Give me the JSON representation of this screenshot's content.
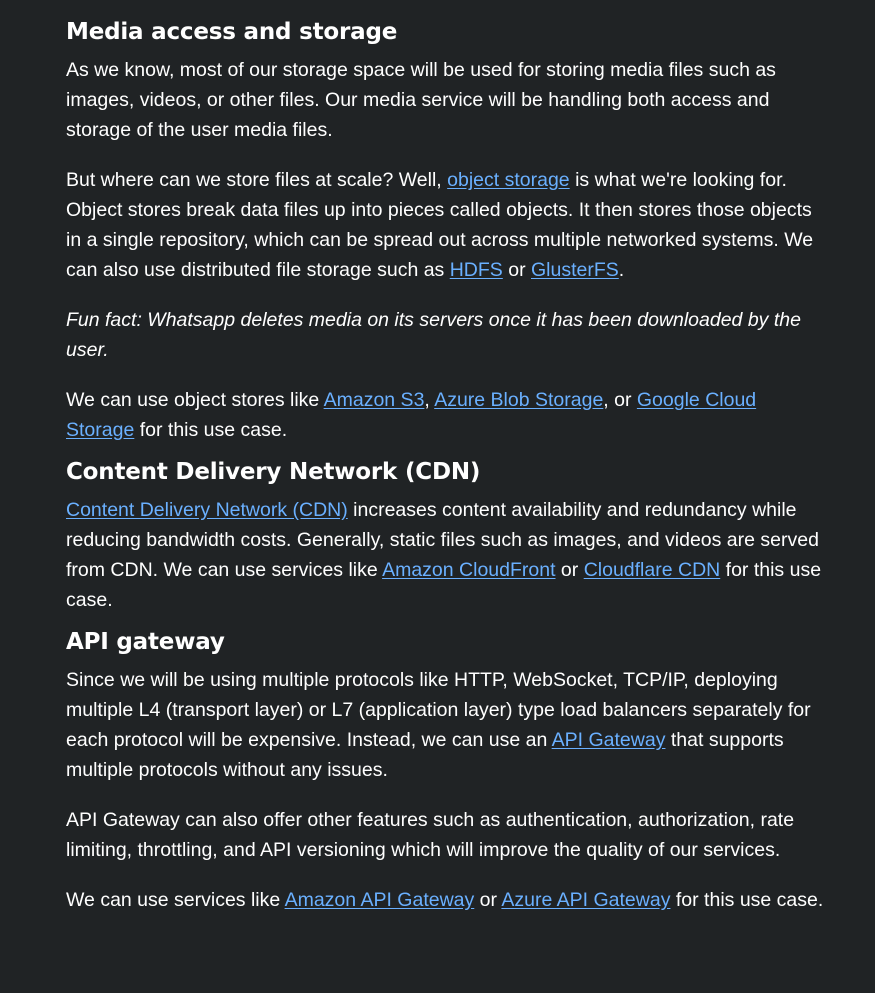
{
  "sections": {
    "media": {
      "heading": "Media access and storage",
      "p1": "As we know, most of our storage space will be used for storing media files such as images, videos, or other files. Our media service will be handling both access and storage of the user media files.",
      "p2_a": "But where can we store files at scale? Well, ",
      "p2_link_object_storage": "object storage",
      "p2_b": " is what we're looking for. Object stores break data files up into pieces called objects. It then stores those objects in a single repository, which can be spread out across multiple networked systems. We can also use distributed file storage such as ",
      "p2_link_hdfs": "HDFS",
      "p2_c": " or ",
      "p2_link_glusterfs": "GlusterFS",
      "p2_d": ".",
      "fun_fact": "Fun fact: Whatsapp deletes media on its servers once it has been downloaded by the user.",
      "p4_a": "We can use object stores like ",
      "p4_link_s3": "Amazon S3",
      "p4_b": ", ",
      "p4_link_azure_blob": "Azure Blob Storage",
      "p4_c": ", or ",
      "p4_link_gcs": "Google Cloud Storage",
      "p4_d": " for this use case."
    },
    "cdn": {
      "heading": "Content Delivery Network (CDN)",
      "p1_link_cdn": "Content Delivery Network (CDN)",
      "p1_a": " increases content availability and redundancy while reducing bandwidth costs. Generally, static files such as images, and videos are served from CDN. We can use services like ",
      "p1_link_cloudfront": "Amazon CloudFront",
      "p1_b": " or ",
      "p1_link_cloudflare": "Cloudflare CDN",
      "p1_c": " for this use case."
    },
    "api": {
      "heading": "API gateway",
      "p1_a": "Since we will be using multiple protocols like HTTP, WebSocket, TCP/IP, deploying multiple L4 (transport layer) or L7 (application layer) type load balancers separately for each protocol will be expensive. Instead, we can use an ",
      "p1_link_api_gateway": "API Gateway",
      "p1_b": " that supports multiple protocols without any issues.",
      "p2": "API Gateway can also offer other features such as authentication, authorization, rate limiting, throttling, and API versioning which will improve the quality of our services.",
      "p3_a": "We can use services like ",
      "p3_link_amazon_api": "Amazon API Gateway",
      "p3_b": " or ",
      "p3_link_azure_api": "Azure API Gateway",
      "p3_c": " for this use case."
    }
  },
  "colors": {
    "background": "#202325",
    "text": "#ffffff",
    "link": "#6ab0ff"
  }
}
